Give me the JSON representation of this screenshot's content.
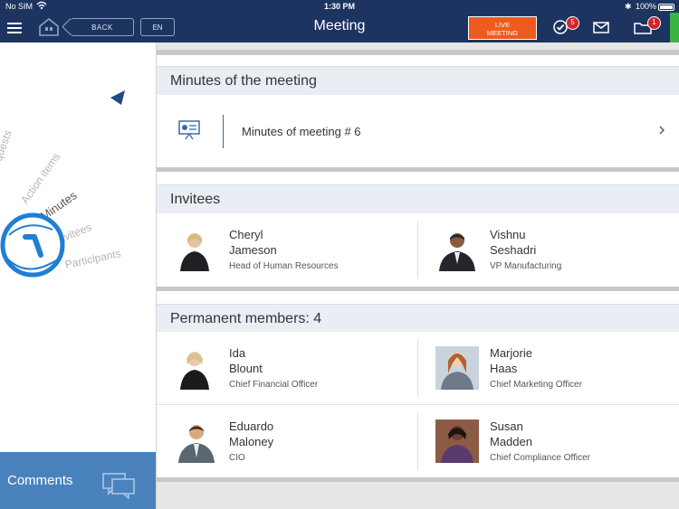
{
  "status_bar": {
    "carrier": "No SIM",
    "time": "1:30 PM",
    "battery": "100%"
  },
  "nav": {
    "back_label": "BACK",
    "lang_label": "EN",
    "title": "Meeting",
    "live_line1": "LIVE",
    "live_line2": "MEETING",
    "tasks_badge": "5",
    "docs_badge": "1"
  },
  "sidebar": {
    "dial_items": [
      "Requests",
      "Action items",
      "Minutes",
      "Invitees",
      "Participants"
    ],
    "selected": "Minutes",
    "comments_label": "Comments"
  },
  "minutes": {
    "header": "Minutes of the meeting",
    "item_label": "Minutes of meeting # 6"
  },
  "invitees": {
    "header": "Invitees",
    "people": [
      {
        "first": "Cheryl",
        "last": "Jameson",
        "role": "Head of Human Resources"
      },
      {
        "first": "Vishnu",
        "last": "Seshadri",
        "role": "VP Manufacturing"
      }
    ]
  },
  "members": {
    "header": "Permanent members: 4",
    "people": [
      {
        "first": "Ida",
        "last": "Blount",
        "role": "Chief Financial Officer"
      },
      {
        "first": "Marjorie",
        "last": "Haas",
        "role": "Chief Marketing Officer"
      },
      {
        "first": "Eduardo",
        "last": "Maloney",
        "role": "CIO"
      },
      {
        "first": "Susan",
        "last": "Madden",
        "role": "Chief Compliance Officer"
      }
    ]
  },
  "colors": {
    "nav_bg": "#1d3461",
    "live_accent": "#ef5a1e",
    "badge_red": "#d0262d",
    "sidebar_accent": "#1f7fd4",
    "comments_bg": "#4a82bd",
    "section_header_bg": "#e9eef5"
  },
  "icons": [
    "hamburger-icon",
    "home-icon",
    "check-icon",
    "mail-icon",
    "folder-icon",
    "presentation-icon",
    "chevron-right-icon",
    "dial-pointer-icon",
    "dial-knob-icon",
    "comments-icon"
  ]
}
